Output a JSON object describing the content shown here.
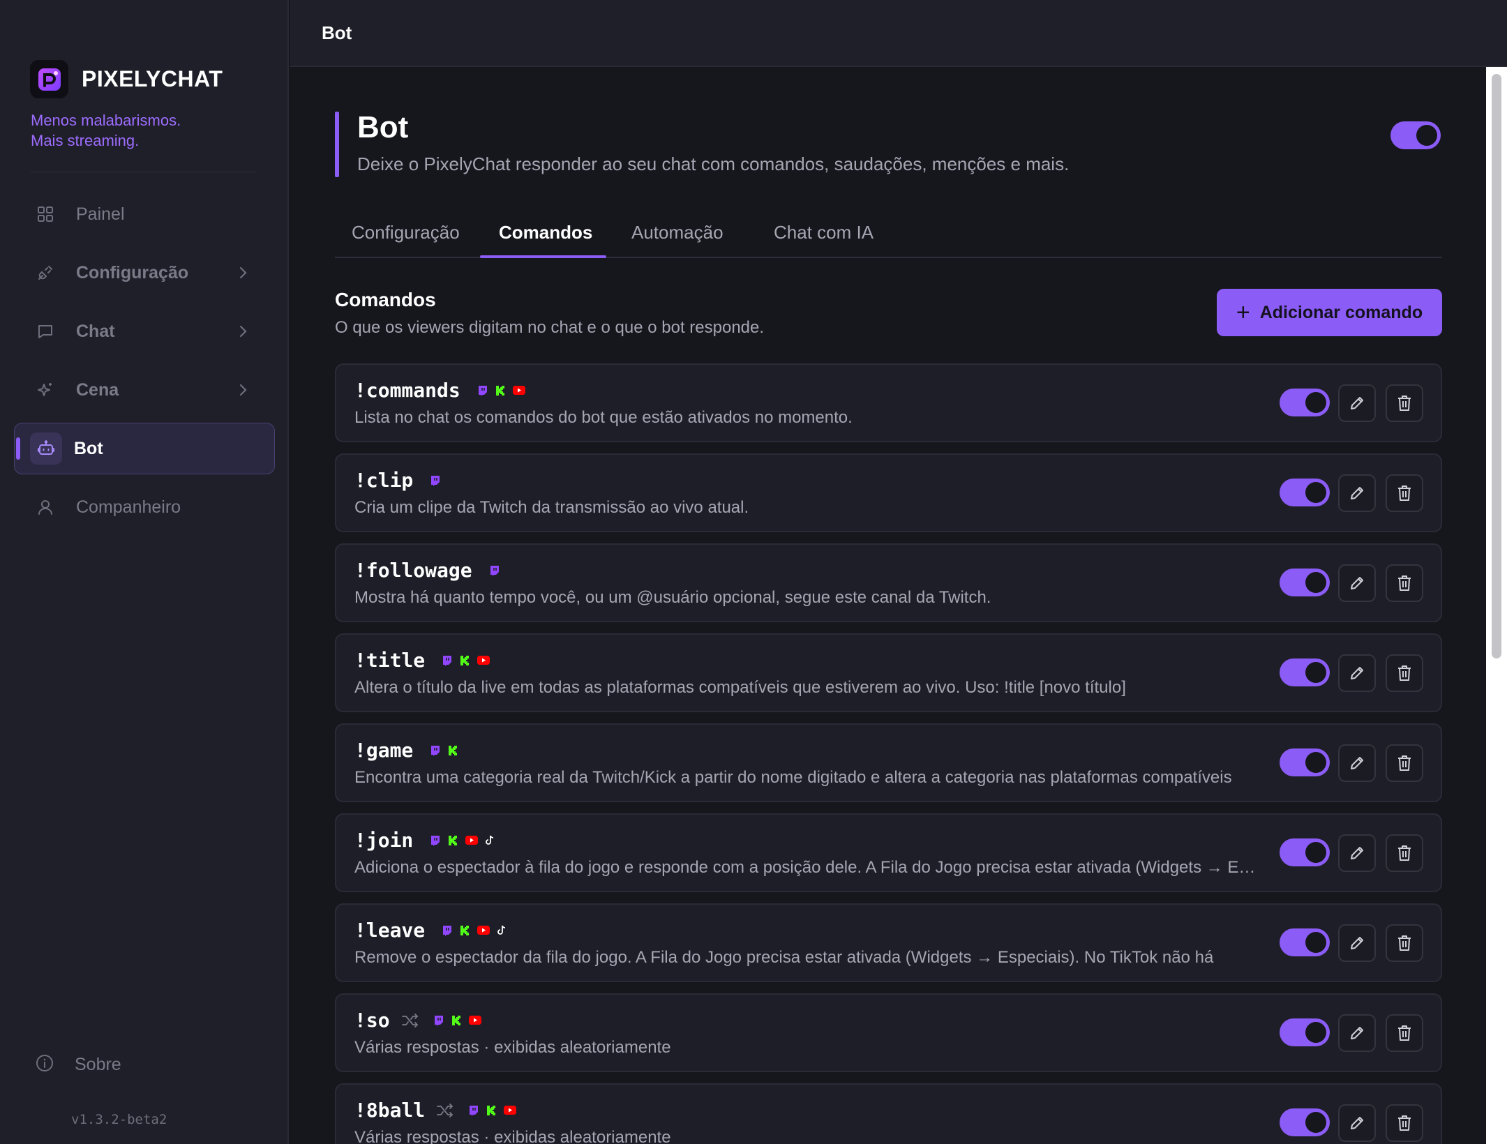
{
  "app": {
    "brand": "PIXELYCHAT",
    "tagline_line1": "Menos malabarismos.",
    "tagline_line2": "Mais streaming.",
    "version": "v1.3.2-beta2"
  },
  "sidebar": {
    "items": [
      {
        "label": "Painel",
        "icon": "grid-icon"
      },
      {
        "label": "Configuração",
        "icon": "plug-icon"
      },
      {
        "label": "Chat",
        "icon": "chat-bubble-icon"
      },
      {
        "label": "Cena",
        "icon": "sparkles-icon"
      },
      {
        "label": "Bot",
        "icon": "robot-icon"
      },
      {
        "label": "Companheiro",
        "icon": "user-icon"
      }
    ],
    "about_label": "Sobre"
  },
  "topbar": {
    "title": "Bot"
  },
  "page": {
    "title": "Bot",
    "subtitle": "Deixe o PixelyChat responder ao seu chat com comandos, saudações, menções e mais.",
    "enabled": true
  },
  "tabs": [
    {
      "label": "Configuração",
      "active": false
    },
    {
      "label": "Comandos",
      "active": true
    },
    {
      "label": "Automação",
      "active": false
    },
    {
      "label": "Chat com IA",
      "active": false
    }
  ],
  "section": {
    "title": "Comandos",
    "subtitle": "O que os viewers digitam no chat e o que o bot responde.",
    "add_button": "Adicionar comando"
  },
  "colors": {
    "accent": "#8b5cf6",
    "twitch": "#9146ff",
    "kick": "#53fc18",
    "youtube": "#ff0000",
    "tiktok": "#ffffff"
  },
  "commands": [
    {
      "name": "!commands",
      "random": false,
      "platforms": [
        "twitch",
        "kick",
        "youtube"
      ],
      "description": "Lista no chat os comandos do bot que estão ativados no momento.",
      "enabled": true
    },
    {
      "name": "!clip",
      "random": false,
      "platforms": [
        "twitch"
      ],
      "description": "Cria um clipe da Twitch da transmissão ao vivo atual.",
      "enabled": true
    },
    {
      "name": "!followage",
      "random": false,
      "platforms": [
        "twitch"
      ],
      "description": "Mostra há quanto tempo você, ou um @usuário opcional, segue este canal da Twitch.",
      "enabled": true
    },
    {
      "name": "!title",
      "random": false,
      "platforms": [
        "twitch",
        "kick",
        "youtube"
      ],
      "description": "Altera o título da live em todas as plataformas compatíveis que estiverem ao vivo. Uso: !title [novo título]",
      "enabled": true
    },
    {
      "name": "!game",
      "random": false,
      "platforms": [
        "twitch",
        "kick"
      ],
      "description": "Encontra uma categoria real da Twitch/Kick a partir do nome digitado e altera a categoria nas plataformas compatíveis",
      "enabled": true
    },
    {
      "name": "!join",
      "random": false,
      "platforms": [
        "twitch",
        "kick",
        "youtube",
        "tiktok"
      ],
      "description": "Adiciona o espectador à fila do jogo e responde com a posição dele. A Fila do Jogo precisa estar ativada (Widgets → Especiais)",
      "enabled": true
    },
    {
      "name": "!leave",
      "random": false,
      "platforms": [
        "twitch",
        "kick",
        "youtube",
        "tiktok"
      ],
      "description": "Remove o espectador da fila do jogo. A Fila do Jogo precisa estar ativada (Widgets → Especiais). No TikTok não há",
      "enabled": true
    },
    {
      "name": "!so",
      "random": true,
      "platforms": [
        "twitch",
        "kick",
        "youtube"
      ],
      "description": "Várias respostas · exibidas aleatoriamente",
      "enabled": true
    },
    {
      "name": "!8ball",
      "random": true,
      "platforms": [
        "twitch",
        "kick",
        "youtube"
      ],
      "description": "Várias respostas · exibidas aleatoriamente",
      "enabled": true
    }
  ]
}
